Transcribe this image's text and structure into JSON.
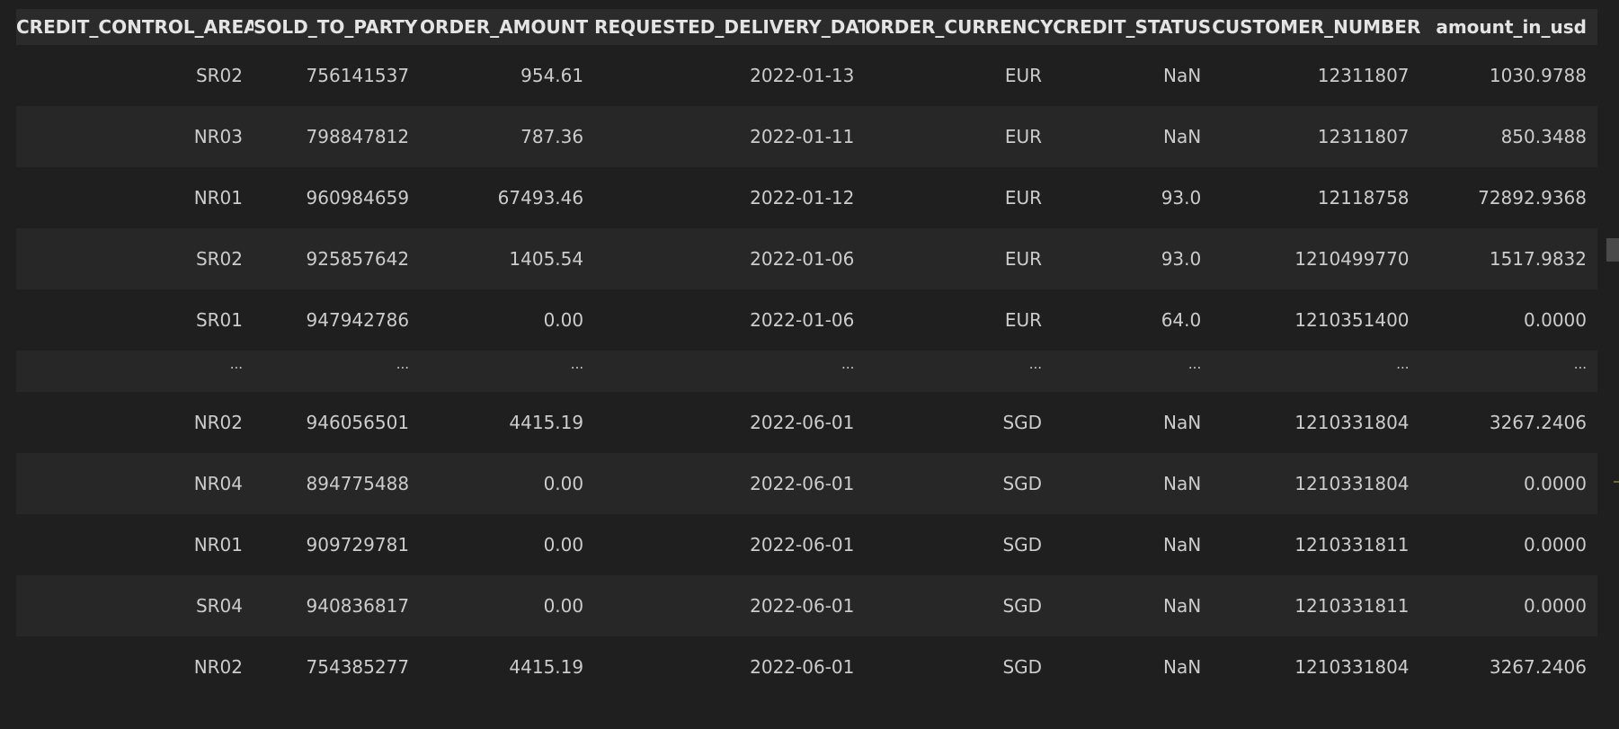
{
  "table": {
    "columns": [
      "CREDIT_CONTROL_AREA",
      "SOLD_TO_PARTY",
      "ORDER_AMOUNT",
      "REQUESTED_DELIVERY_DATE",
      "ORDER_CURRENCY",
      "CREDIT_STATUS",
      "CUSTOMER_NUMBER",
      "amount_in_usd"
    ],
    "rows": [
      [
        "SR02",
        "756141537",
        "954.61",
        "2022-01-13",
        "EUR",
        "NaN",
        "12311807",
        "1030.9788"
      ],
      [
        "NR03",
        "798847812",
        "787.36",
        "2022-01-11",
        "EUR",
        "NaN",
        "12311807",
        "850.3488"
      ],
      [
        "NR01",
        "960984659",
        "67493.46",
        "2022-01-12",
        "EUR",
        "93.0",
        "12118758",
        "72892.9368"
      ],
      [
        "SR02",
        "925857642",
        "1405.54",
        "2022-01-06",
        "EUR",
        "93.0",
        "1210499770",
        "1517.9832"
      ],
      [
        "SR01",
        "947942786",
        "0.00",
        "2022-01-06",
        "EUR",
        "64.0",
        "1210351400",
        "0.0000"
      ],
      [
        "...",
        "...",
        "...",
        "...",
        "...",
        "...",
        "...",
        "..."
      ],
      [
        "NR02",
        "946056501",
        "4415.19",
        "2022-06-01",
        "SGD",
        "NaN",
        "1210331804",
        "3267.2406"
      ],
      [
        "NR04",
        "894775488",
        "0.00",
        "2022-06-01",
        "SGD",
        "NaN",
        "1210331804",
        "0.0000"
      ],
      [
        "NR01",
        "909729781",
        "0.00",
        "2022-06-01",
        "SGD",
        "NaN",
        "1210331811",
        "0.0000"
      ],
      [
        "SR04",
        "940836817",
        "0.00",
        "2022-06-01",
        "SGD",
        "NaN",
        "1210331811",
        "0.0000"
      ],
      [
        "NR02",
        "754385277",
        "4415.19",
        "2022-06-01",
        "SGD",
        "NaN",
        "1210331804",
        "3267.2406"
      ]
    ]
  },
  "colors": {
    "background": "#1f1f1f",
    "header_background": "#2b2b2b",
    "row_stripe": "#272727",
    "text": "#cccccc",
    "header_text": "#e4e4e4"
  }
}
